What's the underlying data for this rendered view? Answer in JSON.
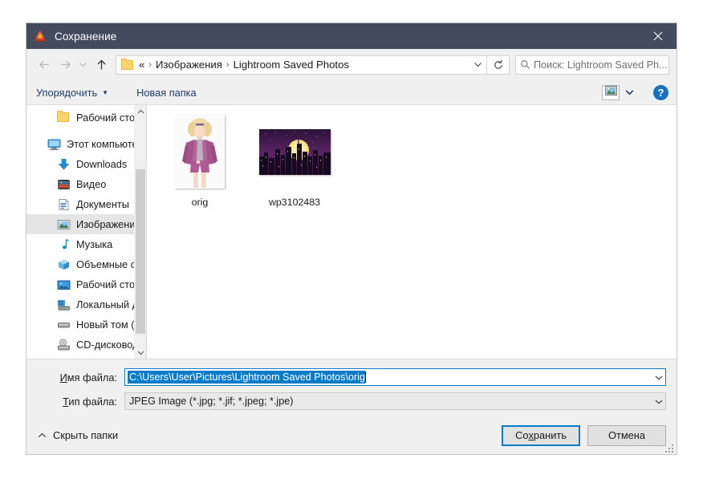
{
  "window": {
    "title": "Сохранение",
    "app_icon": "flame-icon",
    "close_label": "✕"
  },
  "nav": {
    "back_icon": "arrow-left-icon",
    "forward_icon": "arrow-right-icon",
    "recent_icon": "chevron-down-icon",
    "up_icon": "arrow-up-icon",
    "breadcrumb": {
      "folder_icon": "folder-icon",
      "overflow": "«",
      "separator": "›",
      "items": [
        "Изображения",
        "Lightroom Saved Photos"
      ]
    },
    "dropdown_icon": "chevron-down-icon",
    "refresh_icon": "refresh-icon"
  },
  "search": {
    "icon": "search-icon",
    "placeholder": "Поиск: Lightroom Saved Ph..."
  },
  "toolbar": {
    "organize_label": "Упорядочить",
    "organize_caret": "▼",
    "new_folder_label": "Новая папка",
    "view_icon": "picture-view-icon",
    "view_caret_icon": "chevron-down-icon",
    "help_label": "?"
  },
  "sidebar": {
    "items": [
      {
        "label": "Рабочий стол",
        "icon": "folder-icon",
        "indent": 2,
        "selected": false
      },
      {
        "label": "Этот компьютер",
        "icon": "computer-icon",
        "indent": 1,
        "selected": false
      },
      {
        "label": "Downloads",
        "icon": "downloads-icon",
        "indent": 2,
        "selected": false
      },
      {
        "label": "Видео",
        "icon": "video-icon",
        "indent": 2,
        "selected": false
      },
      {
        "label": "Документы",
        "icon": "documents-icon",
        "indent": 2,
        "selected": false
      },
      {
        "label": "Изображения",
        "icon": "pictures-icon",
        "indent": 2,
        "selected": true
      },
      {
        "label": "Музыка",
        "icon": "music-icon",
        "indent": 2,
        "selected": false
      },
      {
        "label": "Объемные объ",
        "icon": "3d-objects-icon",
        "indent": 2,
        "selected": false
      },
      {
        "label": "Рабочий стол",
        "icon": "desktop-icon",
        "indent": 2,
        "selected": false
      },
      {
        "label": "Локальный дис",
        "icon": "local-disk-icon",
        "indent": 2,
        "selected": false
      },
      {
        "label": "Новый том (D:)",
        "icon": "drive-icon",
        "indent": 2,
        "selected": false
      },
      {
        "label": "CD-дисковод (F",
        "icon": "cd-drive-icon",
        "indent": 2,
        "selected": false
      }
    ],
    "scroll_up_icon": "chevron-up-icon",
    "scroll_down_icon": "chevron-down-icon"
  },
  "files": [
    {
      "name": "orig",
      "kind": "portrait-photo"
    },
    {
      "name": "wp3102483",
      "kind": "landscape-photo"
    }
  ],
  "form": {
    "filename_label": "Имя файла:",
    "filename_label_accel": "И",
    "filename_value": "C:\\Users\\User\\Pictures\\Lightroom Saved Photos\\orig",
    "filetype_label": "Тип файла:",
    "filetype_label_accel": "Т",
    "filetype_value": "JPEG Image (*.jpg; *.jif; *.jpeg; *.jpe)",
    "combo_icon": "chevron-down-icon"
  },
  "footer": {
    "hide_folders_label": "Скрыть папки",
    "hide_folders_icon": "chevron-up-icon",
    "save_label": "Сохранить",
    "save_accel": "х",
    "cancel_label": "Отмена",
    "grip_icon": "resize-grip-icon"
  },
  "colors": {
    "titlebar": "#434b5e",
    "accent": "#0a7bc6",
    "link": "#1f3c68",
    "chrome": "#f0f0f0",
    "selection": "#0a7bc6"
  }
}
